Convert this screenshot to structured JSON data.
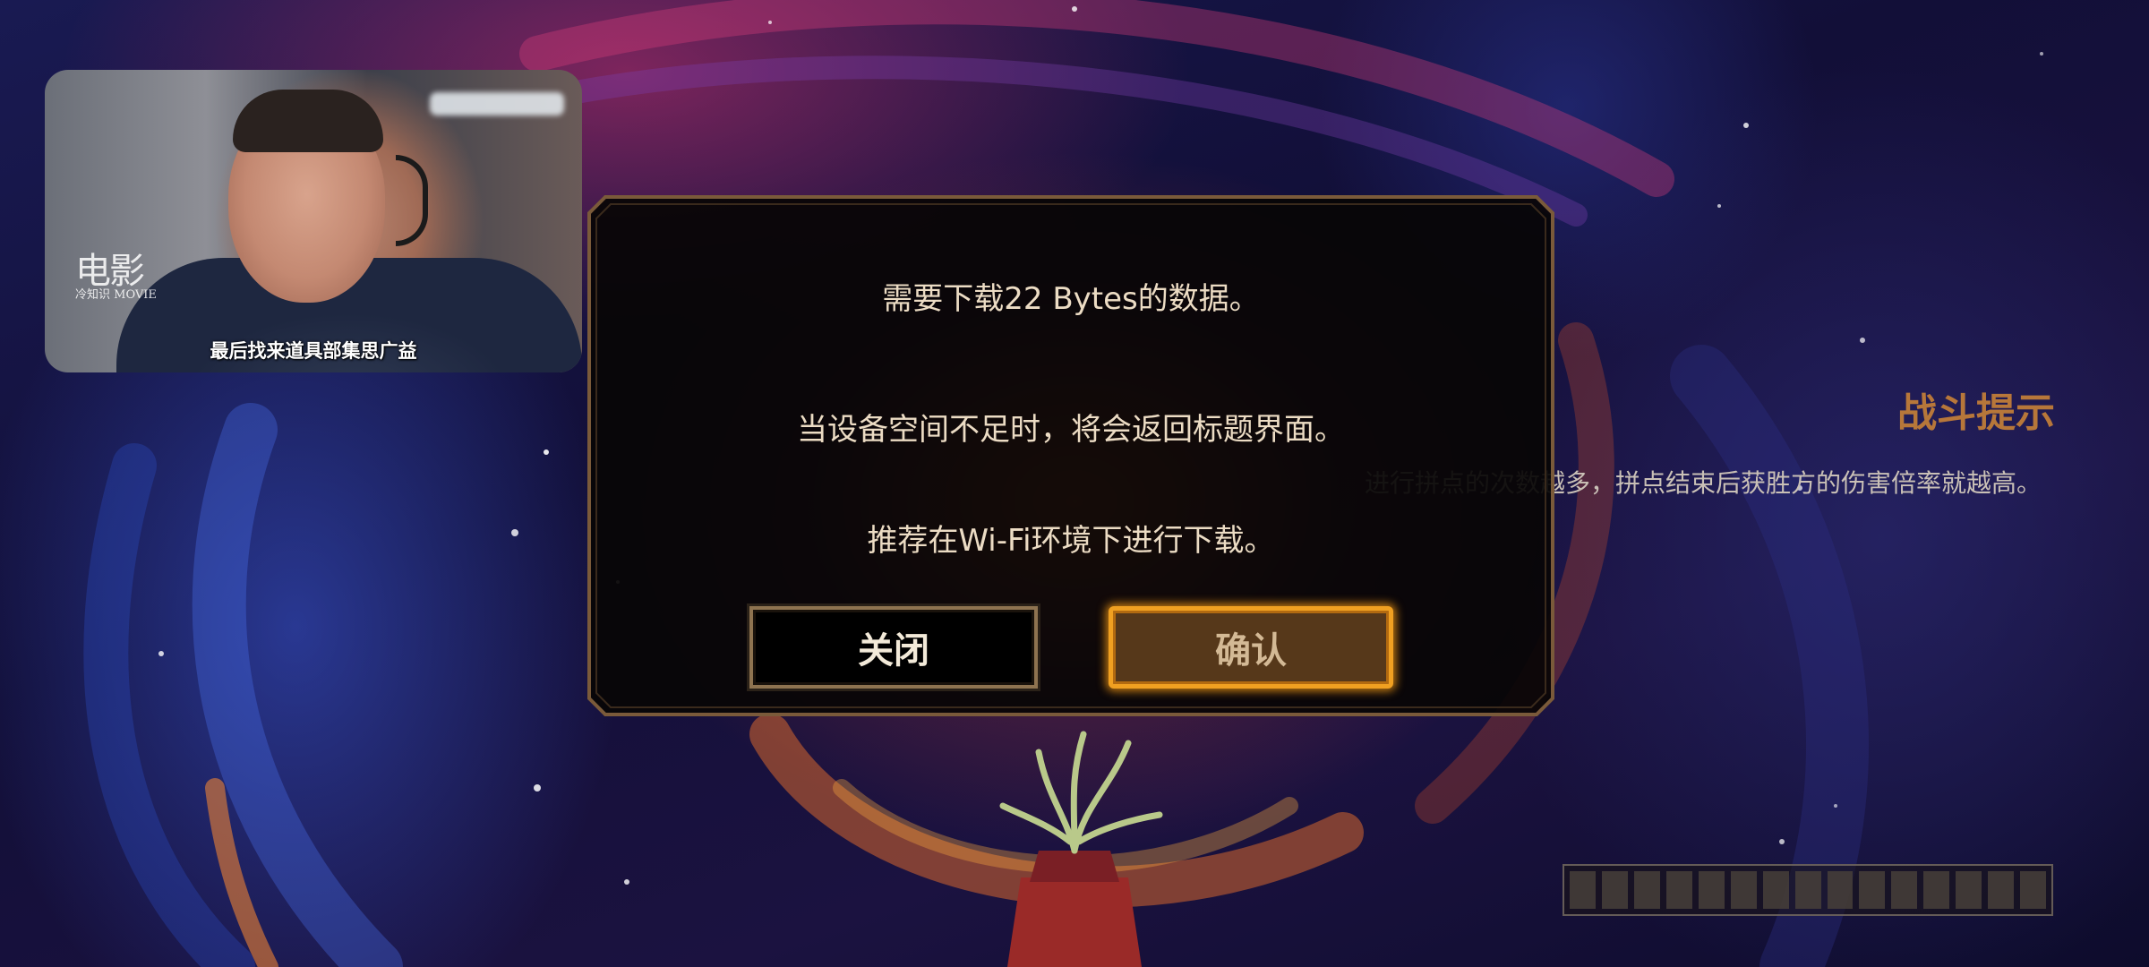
{
  "video_overlay": {
    "watermark_main": "电影",
    "watermark_small": "冷知识",
    "watermark_tag": "MOVIE",
    "subtitle": "最后找来道具部集思广益"
  },
  "battle_tip": {
    "title": "战斗提示",
    "body": "进行拼点的次数越多，拼点结束后获胜方的伤害倍率就越高。"
  },
  "download_dialog": {
    "line1": "需要下载22 Bytes的数据。",
    "line2": "当设备空间不足时，将会返回标题界面。",
    "line3": "推荐在Wi-Fi环境下进行下载。",
    "close_label": "关闭",
    "confirm_label": "确认"
  },
  "loading_bar": {
    "segments": 15,
    "filled": 0
  },
  "colors": {
    "dialog_text": "#ecdcc4",
    "dialog_border": "#7a5a3a",
    "confirm_border": "#f0a021",
    "tip_title": "#b7773a"
  }
}
